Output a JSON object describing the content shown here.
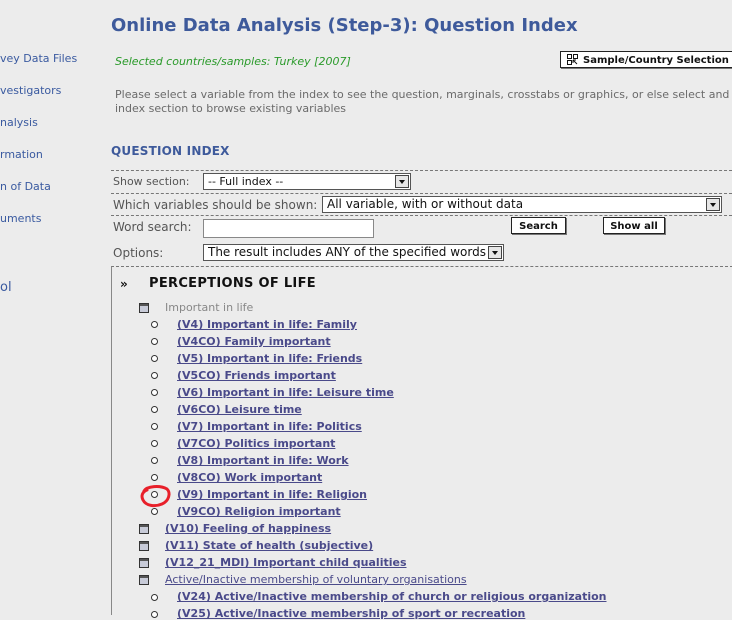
{
  "sidebar": {
    "items": [
      "vey Data Files",
      "vestigators",
      "nalysis",
      "rmation",
      "n of Data",
      "uments",
      "ol"
    ]
  },
  "header": {
    "title": "Online Data Analysis (Step-3): Question Index",
    "selected": "Selected countries/samples: Turkey [2007]",
    "sample_button": "Sample/Country Selection",
    "intro": "Please select a variable from the index to see the question, marginals, crosstabs or graphics, or else select and index section to browse existing variables"
  },
  "question_index": {
    "heading": "QUESTION INDEX",
    "show_section_label": "Show section:",
    "show_section_value": "-- Full index --",
    "variables_label": "Which variables should be shown:",
    "variables_value": "All variable, with or without data",
    "word_search_label": "Word search:",
    "word_search_value": "",
    "search_button": "Search",
    "show_all_button": "Show all",
    "options_label": "Options:",
    "options_value": "The result includes ANY of the specified words"
  },
  "index": {
    "section_icon": "»",
    "section_title": "PERCEPTIONS OF LIFE",
    "group1": "Important in life",
    "group1_items": [
      "(V4) Important in life: Family",
      "(V4CO) Family important",
      "(V5) Important in life: Friends",
      "(V5CO) Friends important",
      "(V6) Important in life: Leisure time",
      "(V6CO) Leisure time",
      "(V7) Important in life: Politics",
      "(V7CO) Politics important",
      "(V8) Important in life: Work",
      "(V8CO) Work important",
      "(V9) Important in life: Religion",
      "(V9CO) Religion important"
    ],
    "top_items": [
      "(V10) Feeling of happiness",
      "(V11) State of health (subjective)",
      "(V12_21_MDI) Important child qualities"
    ],
    "group2": "Active/Inactive membership of voluntary organisations",
    "group2_items": [
      "(V24) Active/Inactive membership of church or religious organization",
      "(V25) Active/Inactive membership of sport or recreation"
    ],
    "highlight_color": "#e8202a"
  }
}
